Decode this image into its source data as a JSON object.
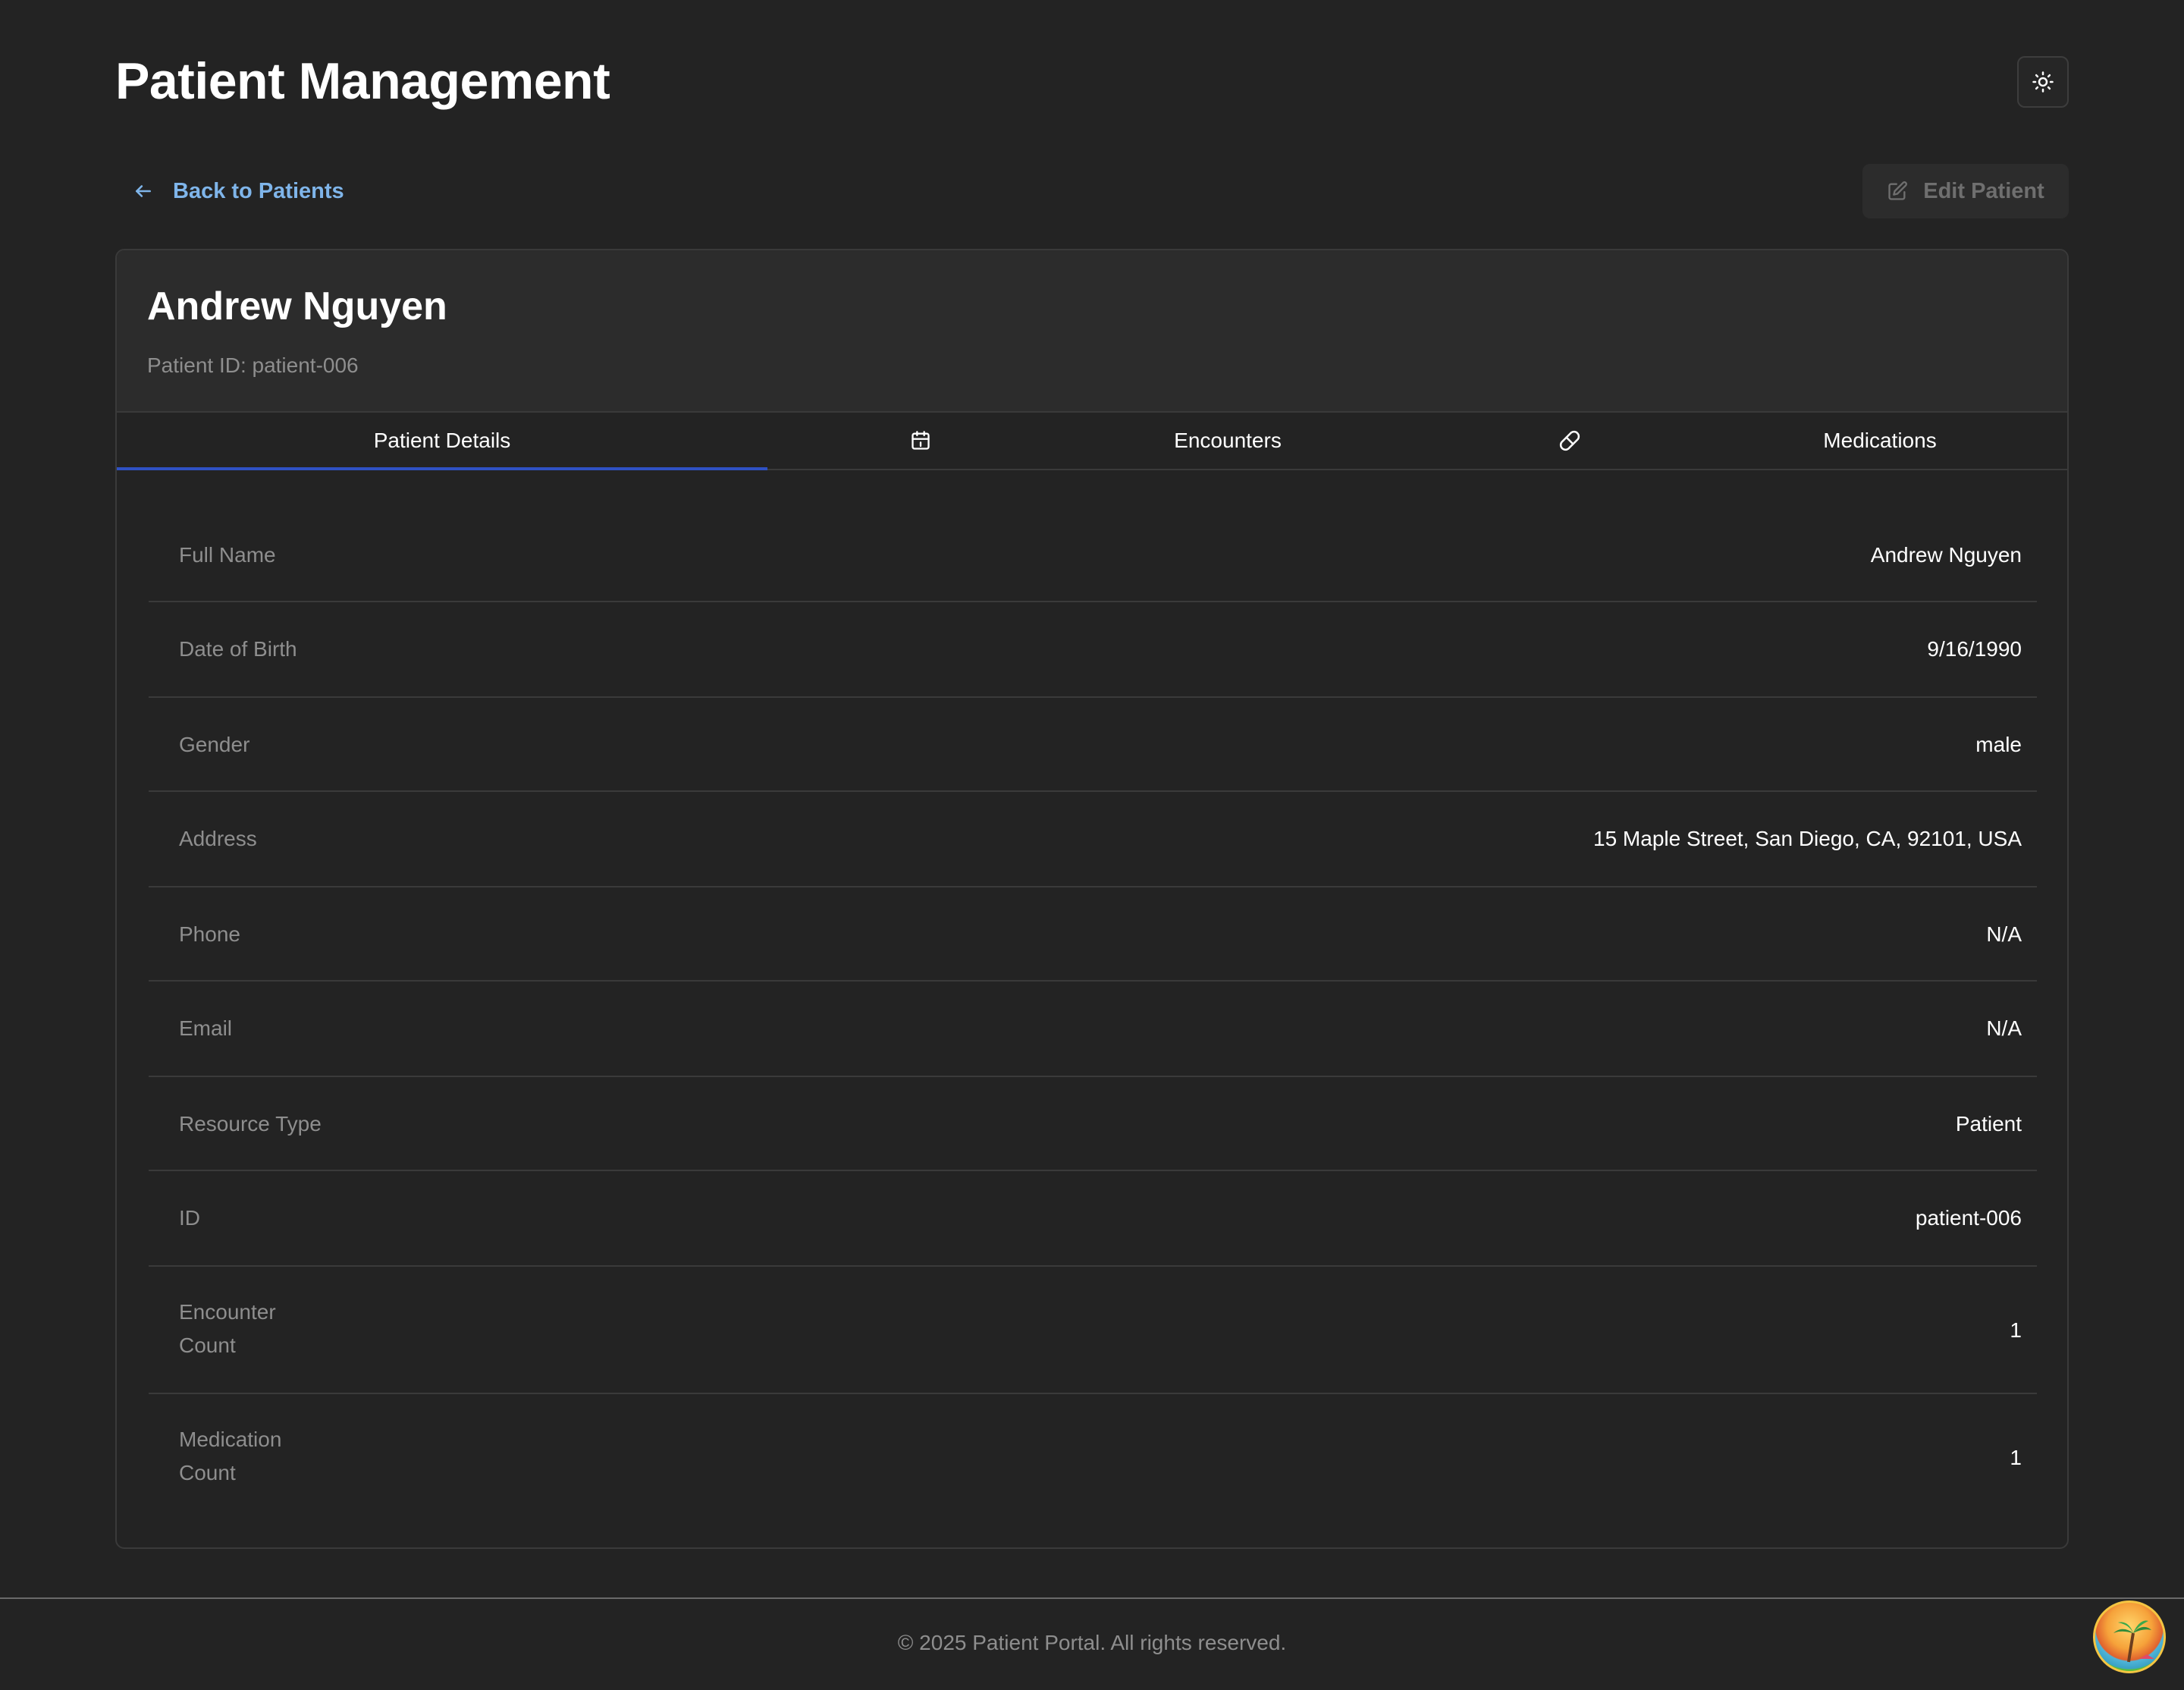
{
  "header": {
    "title": "Patient Management",
    "theme_toggle_icon": "sun-icon"
  },
  "nav": {
    "back_label": "Back to Patients",
    "edit_label": "Edit Patient"
  },
  "patient": {
    "name": "Andrew Nguyen",
    "id_line": "Patient ID: patient-006"
  },
  "tabs": [
    {
      "label": "Patient Details",
      "active": true
    },
    {
      "label": "Encounters",
      "icon": "calendar-icon",
      "active": false
    },
    {
      "label": "Medications",
      "icon": "pill-icon",
      "active": false
    }
  ],
  "details": [
    {
      "label": "Full Name",
      "value": "Andrew Nguyen"
    },
    {
      "label": "Date of Birth",
      "value": "9/16/1990"
    },
    {
      "label": "Gender",
      "value": "male"
    },
    {
      "label": "Address",
      "value": "15 Maple Street, San Diego, CA, 92101, USA"
    },
    {
      "label": "Phone",
      "value": "N/A"
    },
    {
      "label": "Email",
      "value": "N/A"
    },
    {
      "label": "Resource Type",
      "value": "Patient"
    },
    {
      "label": "ID",
      "value": "patient-006"
    },
    {
      "label": "Encounter Count",
      "value": "1"
    },
    {
      "label": "Medication Count",
      "value": "1"
    }
  ],
  "footer": {
    "text": "© 2025 Patient Portal. All rights reserved."
  },
  "colors": {
    "background": "#232323",
    "card_header": "#2c2c2c",
    "link": "#7fb5ea",
    "active_tab": "#2f51c4",
    "muted_text": "#8e8e8e"
  }
}
